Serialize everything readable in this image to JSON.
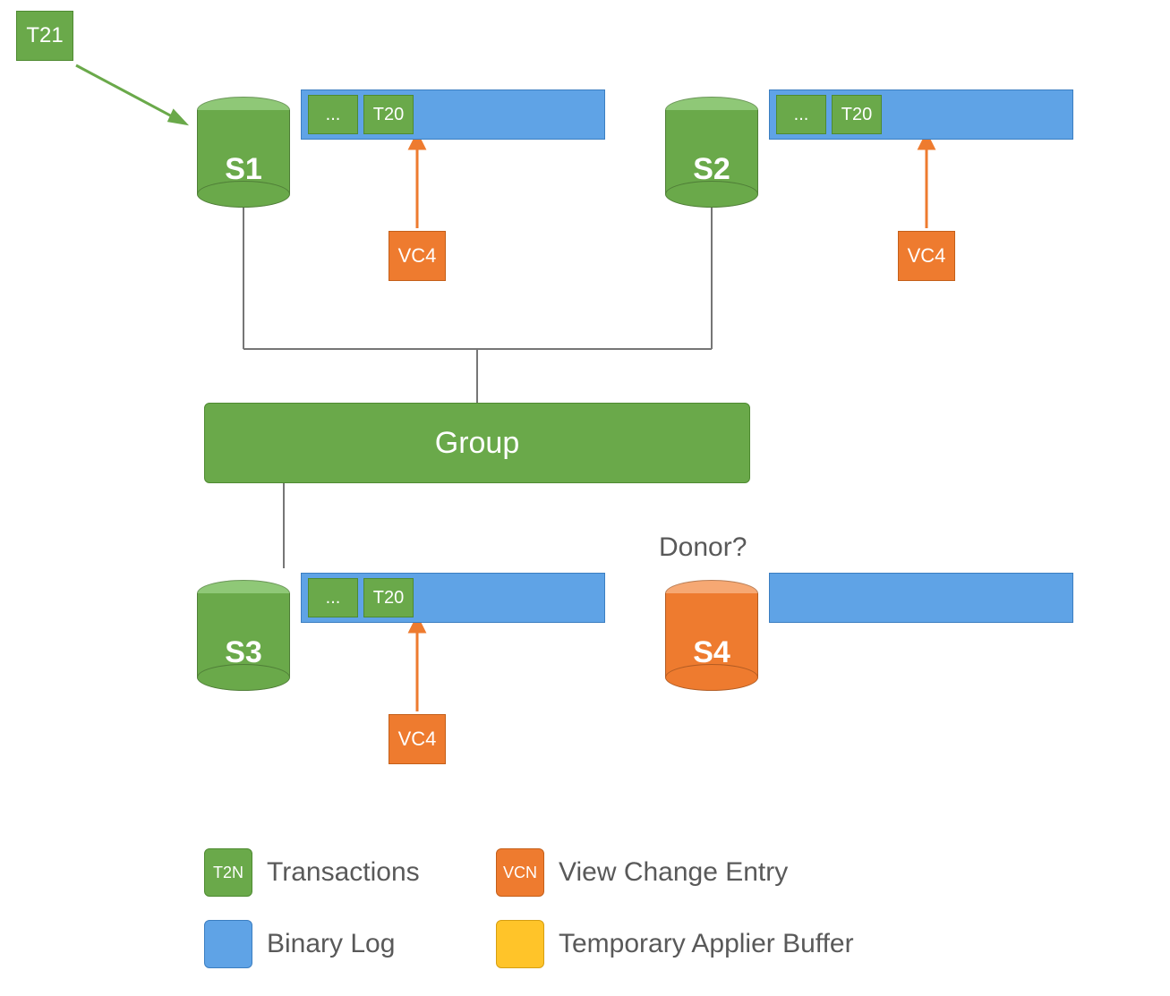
{
  "colors": {
    "green": "#6aa94a",
    "green_light": "#8fc877",
    "orange": "#ee7b2f",
    "orange_light": "#f6a873",
    "blue": "#5fa3e6",
    "yellow": "#ffc429",
    "gray_text": "#595959",
    "connector": "#767676"
  },
  "incoming_transaction": "T21",
  "servers": {
    "s1": {
      "name": "S1",
      "log_entries": [
        "...",
        "T20"
      ],
      "view_change": "VC4"
    },
    "s2": {
      "name": "S2",
      "log_entries": [
        "...",
        "T20"
      ],
      "view_change": "VC4"
    },
    "s3": {
      "name": "S3",
      "log_entries": [
        "...",
        "T20"
      ],
      "view_change": "VC4"
    },
    "s4": {
      "name": "S4",
      "log_entries": [],
      "question": "Donor?"
    }
  },
  "group_label": "Group",
  "legend": {
    "transactions": {
      "swatch_text": "T2N",
      "label": "Transactions"
    },
    "binary_log": {
      "swatch_text": "",
      "label": "Binary Log"
    },
    "view_change": {
      "swatch_text": "VCN",
      "label": "View Change Entry"
    },
    "applier_buf": {
      "swatch_text": "",
      "label": "Temporary Applier Buffer"
    }
  }
}
